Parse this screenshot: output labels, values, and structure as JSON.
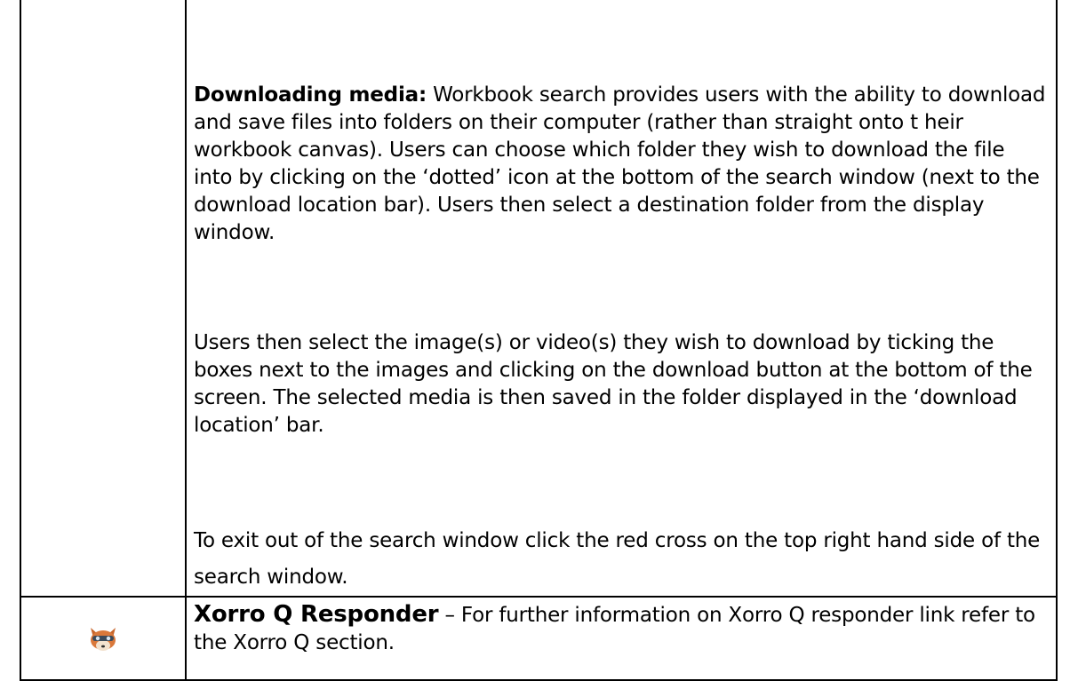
{
  "search_section": {
    "heading": "Downloading media:",
    "paragraph1": " Workbook search provides users with the ability to download and save files into folders on their computer (rather than straight onto t heir workbook canvas).  Users can choose which folder they wish to download the file into by clicking on the ‘dotted’ icon at the bottom of the search window (next to the download location bar).  Users then select a destination folder from the display window.",
    "paragraph2": "Users then select the image(s) or video(s) they wish to download by ticking the boxes next to the images and clicking on the download button at the bottom of the screen. The selected media is then saved in the folder displayed in the ‘download location’ bar.",
    "paragraph3": "To exit out of the search window click the red cross on the top right hand side of the search window."
  },
  "xorro_section": {
    "icon": "xorro-fox-icon",
    "heading": "Xorro Q Responder",
    "text": " – For further information on Xorro Q responder link refer to the Xorro Q section."
  }
}
